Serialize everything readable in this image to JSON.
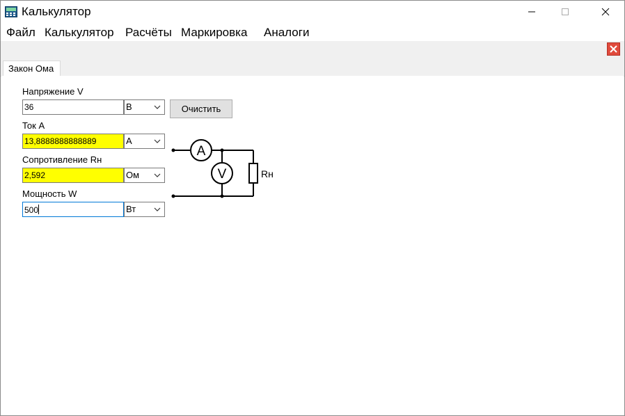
{
  "window": {
    "title": "Калькулятор"
  },
  "menu": [
    "Файл",
    "Калькулятор",
    "Расчёты",
    "Маркировка",
    "Аналоги"
  ],
  "tabs": [
    {
      "label": "Закон Ома",
      "active": true
    }
  ],
  "form": {
    "voltage": {
      "label": "Напряжение V",
      "value": "36",
      "unit": "В"
    },
    "current": {
      "label": "Ток A",
      "value": "13,8888888888889",
      "unit": "А"
    },
    "resistance": {
      "label": "Сопротивление Rн",
      "value": "2,592",
      "unit": "Ом"
    },
    "power": {
      "label": "Мощность W",
      "value": "500",
      "unit": "Вт"
    },
    "clear_button": "Очистить"
  },
  "circuit": {
    "ammeter_label": "A",
    "voltmeter_label": "V",
    "load_label": "Rн"
  },
  "colors": {
    "highlight": "#ffff00",
    "close_accent": "#e04a3c",
    "focus_border": "#0078d7"
  },
  "icons": [
    "calculator-app-icon",
    "minimize-icon",
    "maximize-icon",
    "close-icon",
    "chevron-down-icon",
    "close-tab-icon"
  ]
}
